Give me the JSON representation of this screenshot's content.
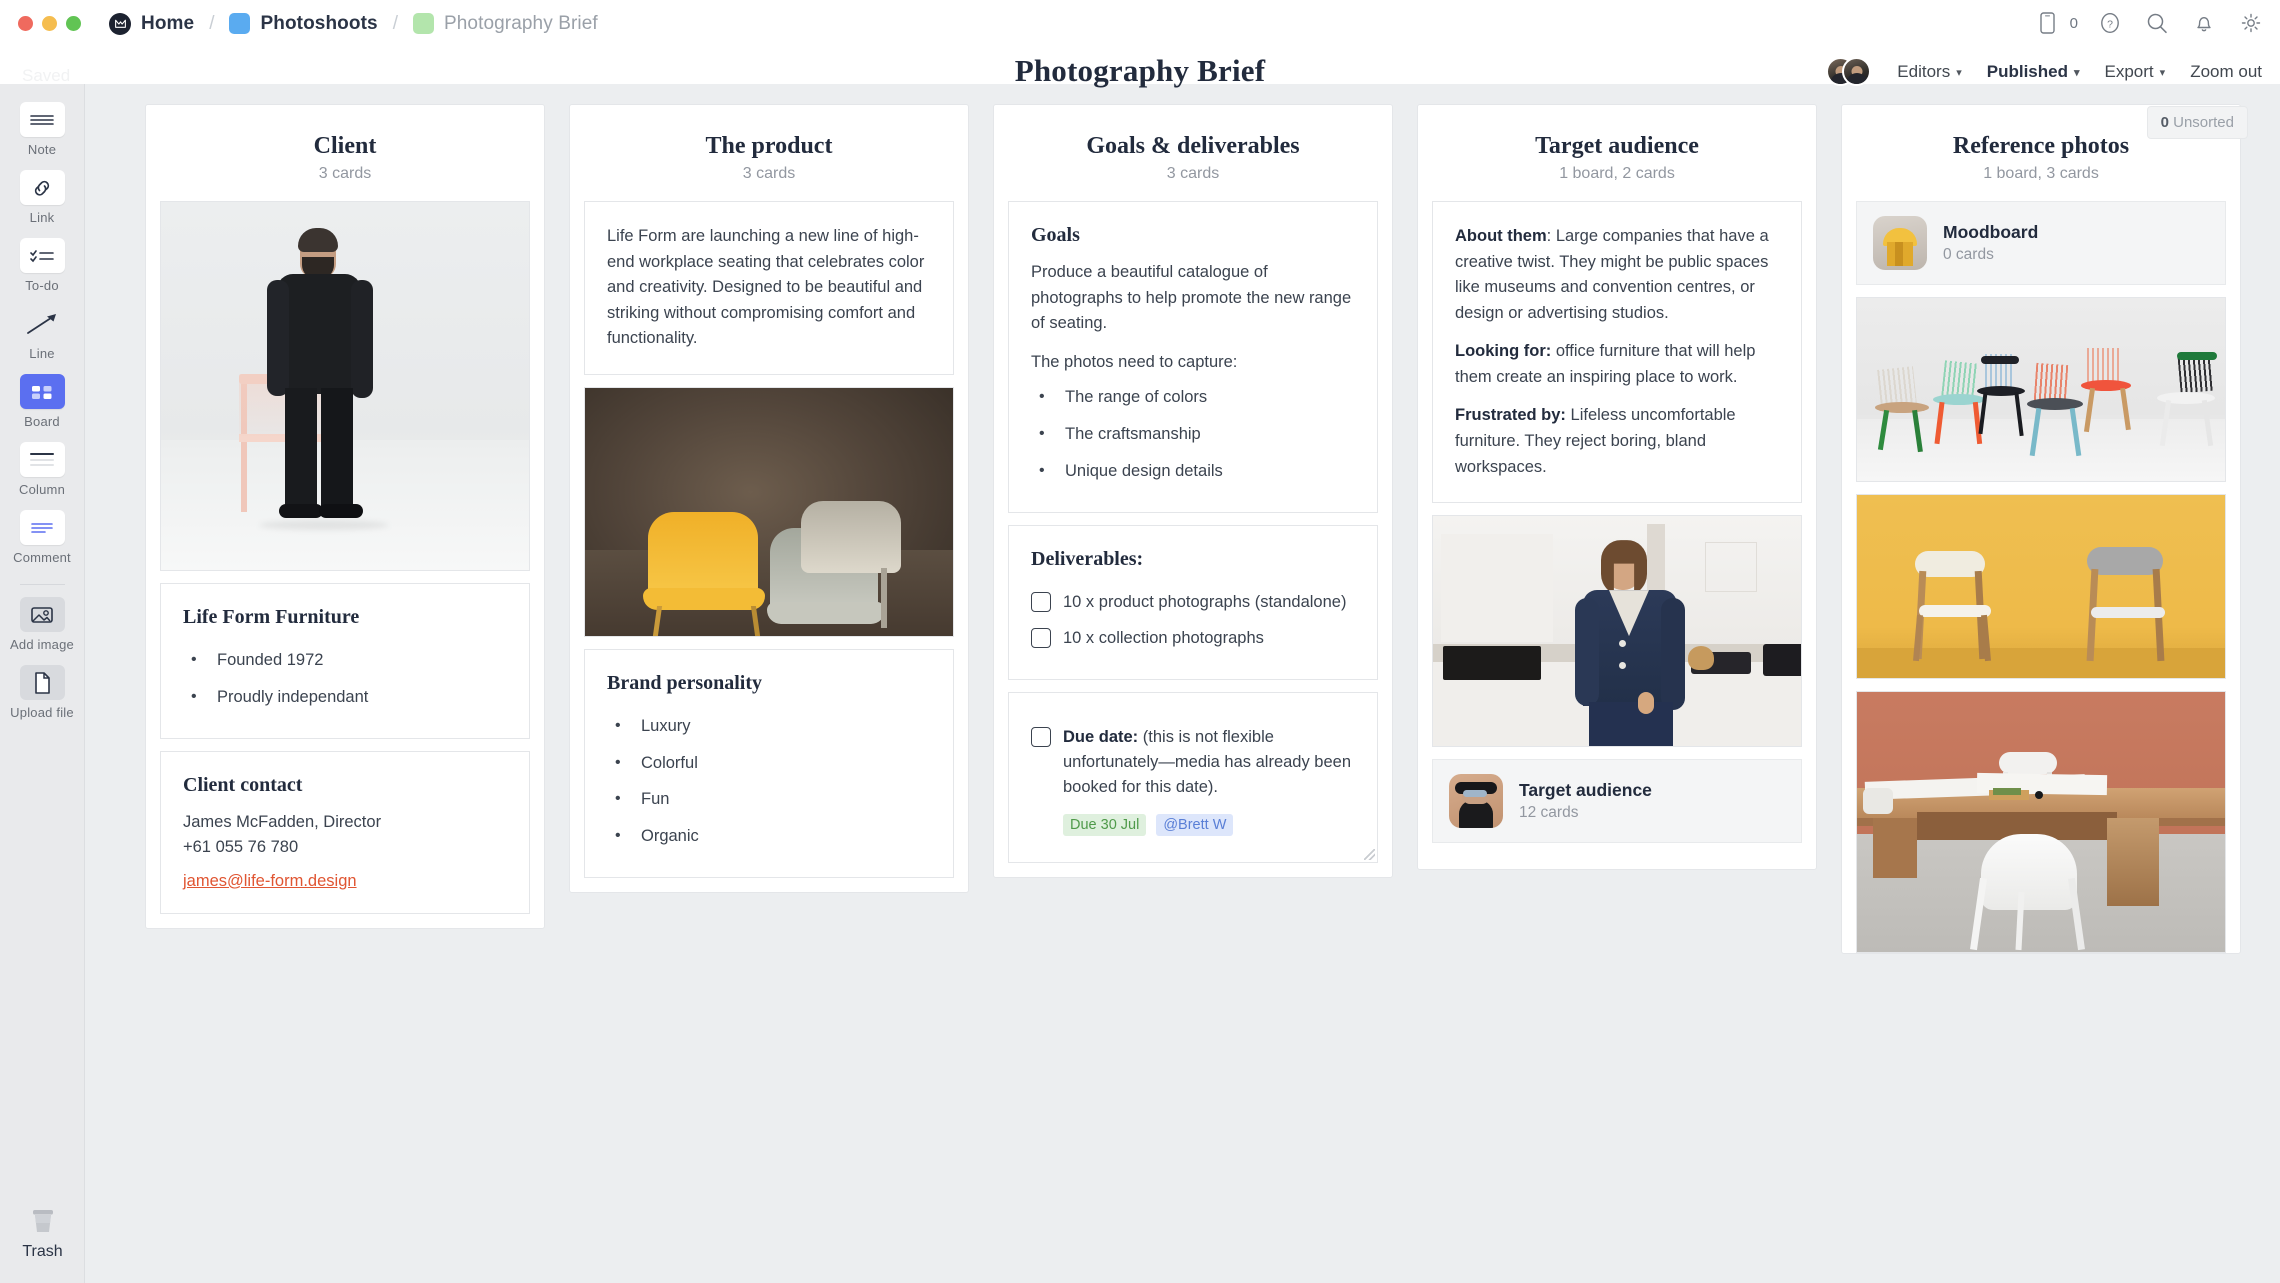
{
  "window": {
    "breadcrumb": [
      {
        "label": "Home",
        "icon": "milanote-logo-icon",
        "muted": false
      },
      {
        "label": "Photoshoots",
        "icon": "blue-swatch-icon",
        "muted": false
      },
      {
        "label": "Photography Brief",
        "icon": "green-swatch-icon",
        "muted": true
      }
    ],
    "separator": "/",
    "top_icons": [
      {
        "name": "mobile-icon",
        "badge": "0"
      },
      {
        "name": "help-icon"
      },
      {
        "name": "search-icon"
      },
      {
        "name": "notifications-icon"
      },
      {
        "name": "settings-gear-icon"
      }
    ]
  },
  "header": {
    "saved_status": "Saved",
    "title": "Photography Brief",
    "editors_label": "Editors",
    "published_label": "Published",
    "export_label": "Export",
    "zoom_label": "Zoom out"
  },
  "toolbar": {
    "items": [
      {
        "label": "Note",
        "icon": "note-icon"
      },
      {
        "label": "Link",
        "icon": "link-icon"
      },
      {
        "label": "To-do",
        "icon": "todo-icon"
      },
      {
        "label": "Line",
        "icon": "line-arrow-icon"
      },
      {
        "label": "Board",
        "icon": "board-icon",
        "active": true
      },
      {
        "label": "Column",
        "icon": "column-icon"
      },
      {
        "label": "Comment",
        "icon": "comment-icon"
      }
    ],
    "items2": [
      {
        "label": "Add image",
        "icon": "image-icon"
      },
      {
        "label": "Upload file",
        "icon": "file-icon"
      }
    ],
    "trash_label": "Trash"
  },
  "canvas": {
    "unsorted_count": "0",
    "unsorted_label": "Unsorted"
  },
  "columns": [
    {
      "title": "Client",
      "subtitle": "3 cards",
      "cards": {
        "photo_caption": "man-standing-with-pink-chair-photo",
        "company_title": "Life Form Furniture",
        "company_bullets": [
          "Founded 1972",
          "Proudly independant"
        ],
        "contact_title": "Client contact",
        "contact_name": "James McFadden, Director",
        "contact_phone": "+61 055 76 780",
        "contact_email": "james@life-form.design"
      }
    },
    {
      "title": "The product",
      "subtitle": "3 cards",
      "cards": {
        "intro": "Life Form are launching a new line of high-end workplace seating that celebrates color and creativity. Designed to be beautiful and striking without compromising comfort and functionality.",
        "photo_caption": "yellow-and-grey-chairs-photo",
        "brand_title": "Brand personality",
        "brand_bullets": [
          "Luxury",
          "Colorful",
          "Fun",
          "Organic"
        ]
      }
    },
    {
      "title": "Goals & deliverables",
      "subtitle": "3 cards",
      "cards": {
        "goals_title": "Goals",
        "goals_p1": "Produce a beautiful catalogue of photographs to help promote the new range of seating.",
        "goals_p2": "The photos need to capture:",
        "goals_bullets": [
          "The range of colors",
          "The craftsmanship",
          "Unique design details"
        ],
        "deliverables_title": "Deliverables:",
        "deliverables_items": [
          "10 x product photographs (standalone)",
          "10 x collection photographs"
        ],
        "due_label": "Due date:",
        "due_text": " (this is not flexible unfortunately—media has already been booked for this date).",
        "due_tag": "Due 30 Jul",
        "mention_tag": "@Brett W"
      }
    },
    {
      "title": "Target audience",
      "subtitle": "1 board, 2 cards",
      "cards": {
        "about_label": "About them",
        "about_text": ": Large companies that have a creative twist. They might be public spaces like museums and convention centres, or design or advertising studios.",
        "looking_label": "Looking for:",
        "looking_text": " office furniture that will help them create an inspiring place to work.",
        "frustrated_label": "Frustrated by:",
        "frustrated_text": " Lifeless uncomfortable furniture. They reject boring, bland workspaces.",
        "photo_caption": "woman-in-navy-suit-photo",
        "board_name": "Target audience",
        "board_sub": "12 cards",
        "board_thumb": "man-with-hat-and-sunglasses-thumb"
      }
    },
    {
      "title": "Reference photos",
      "subtitle": "1 board, 3 cards",
      "cards": {
        "board_name": "Moodboard",
        "board_sub": "0 cards",
        "board_thumb": "yellow-armchair-thumb",
        "photo1_caption": "colorful-chairs-lineup-photo",
        "photo2_caption": "two-chairs-yellow-backdrop-photo",
        "photo3_caption": "wooden-desk-white-chair-photo"
      }
    }
  ],
  "colors": {
    "accent_link": "#e05532",
    "due_tag_bg": "#dff0de",
    "due_tag_fg": "#4f9a4a",
    "mention_bg": "#dde6fb",
    "mention_fg": "#5a7fd6",
    "board_active": "#5b6ff0",
    "canvas_bg": "#eceef0",
    "toolbar_bg": "#e9eaec"
  }
}
